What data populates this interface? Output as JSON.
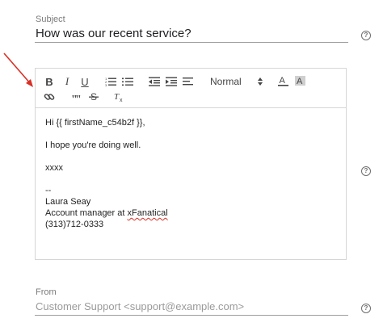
{
  "subject": {
    "label": "Subject",
    "value": "How was our recent service?"
  },
  "editor": {
    "toolbar": {
      "bold_label": "B",
      "italic_label": "I",
      "underline_label": "U",
      "format_value": "Normal",
      "icons": [
        "bold",
        "italic",
        "underline",
        "ordered-list",
        "bullet-list",
        "outdent",
        "indent",
        "align",
        "text-color",
        "highlight-color",
        "link",
        "blockquote",
        "strikethrough",
        "clear-formatting"
      ]
    },
    "body_lines": [
      "Hi {{ firstName_c54b2f }},",
      "",
      "I hope you're doing well.",
      "",
      "xxxx",
      "",
      "--",
      "Laura Seay"
    ],
    "signature_role_prefix": "Account manager at ",
    "signature_company": "xFanatical",
    "signature_phone": "(313)712-0333"
  },
  "from": {
    "label": "From",
    "placeholder": "Customer Support <support@example.com>"
  },
  "help_icon_glyph": "?",
  "annotation_arrow_color": "#d93025"
}
